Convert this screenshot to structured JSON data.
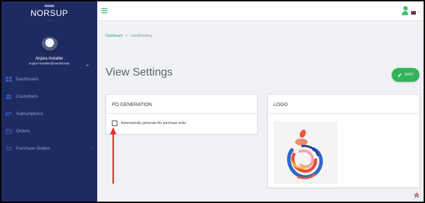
{
  "sidebar": {
    "brand": "NORSUP",
    "brand_sub": "~~~",
    "user": {
      "name": "Anjara Installer",
      "email": "anjara+installer@norsitsmain"
    },
    "items": [
      {
        "label": "Dashboard",
        "icon": "dashboard-icon"
      },
      {
        "label": "Customers",
        "icon": "users-icon"
      },
      {
        "label": "Subscriptions",
        "icon": "subscriptions-icon"
      },
      {
        "label": "Orders",
        "icon": "orders-icon"
      },
      {
        "label": "Purchase Orders",
        "icon": "cart-icon",
        "has_caret": true
      }
    ]
  },
  "topbar": {
    "menu_icon": "hamburger-icon",
    "user_icon": "user-icon",
    "language_icon": "flag-icon"
  },
  "breadcrumb": {
    "home": "Dashboard",
    "separator": ">",
    "current": "UserBranding"
  },
  "page": {
    "title": "View Settings",
    "edit_label": "EDIT"
  },
  "po_card": {
    "title": "PO GENERATION",
    "checkbox_label": "Automatically generate the purchase order",
    "checked": false
  },
  "logo_card": {
    "title": "LOGO"
  },
  "colors": {
    "sidebar_bg": "#1e2b62",
    "accent_green": "#27ae60",
    "annotation_red": "#e0302a"
  }
}
